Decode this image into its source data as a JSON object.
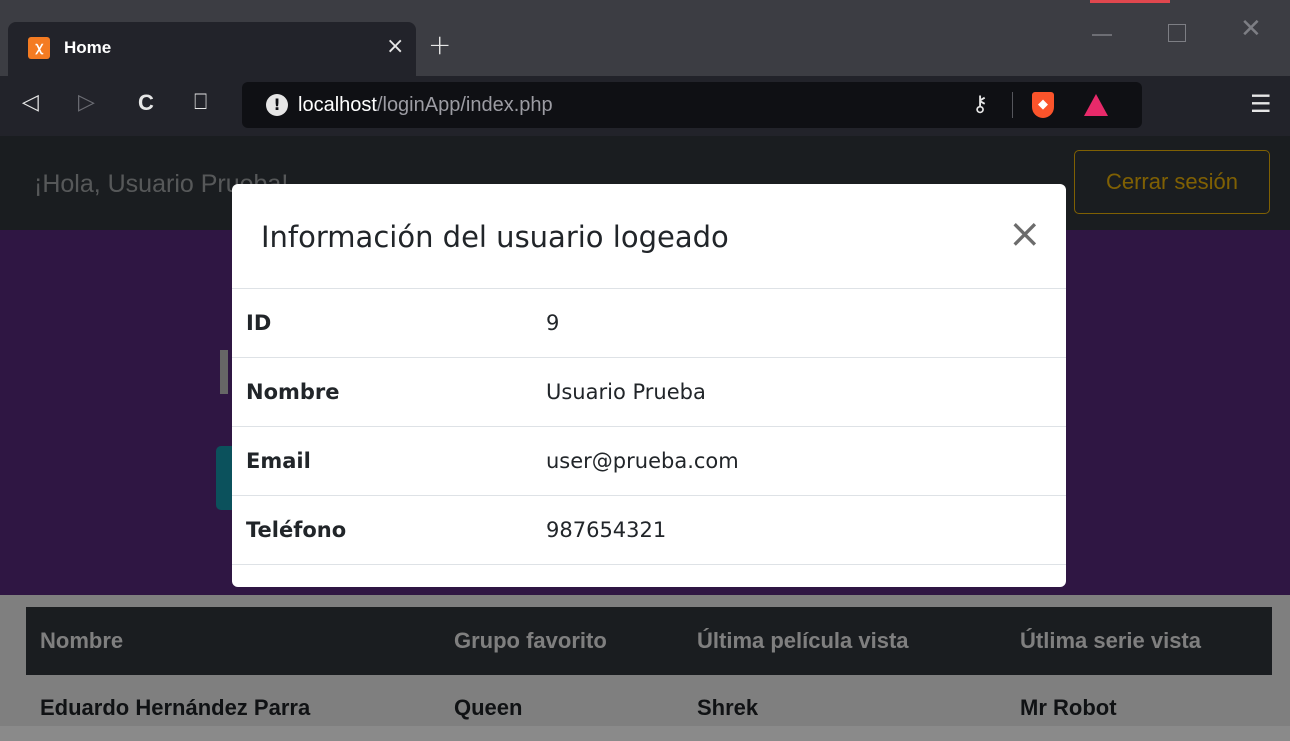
{
  "browser": {
    "tab_title": "Home",
    "tab_close": "×",
    "new_tab": "+",
    "address_host": "localhost",
    "address_path": "/loginApp/index.php",
    "nav": {
      "back": "◁",
      "forward": "▷",
      "reload": "C",
      "bookmark": "⎕"
    },
    "key_icon": "🔑",
    "menu_icon": "☰",
    "accent_color": "#e0474e"
  },
  "page": {
    "greeting": "¡Hola, Usuario Prueba!",
    "logout_label": "Cerrar sesión",
    "table": {
      "headers": [
        "Nombre",
        "Grupo favorito",
        "Última película vista",
        "Útlima serie vista"
      ],
      "rows": [
        [
          "Eduardo Hernández Parra",
          "Queen",
          "Shrek",
          "Mr Robot"
        ]
      ]
    }
  },
  "modal": {
    "title": "Información del usuario logeado",
    "close": "×",
    "rows": [
      {
        "label": "ID",
        "value": "9"
      },
      {
        "label": "Nombre",
        "value": "Usuario Prueba"
      },
      {
        "label": "Email",
        "value": "user@prueba.com"
      },
      {
        "label": "Teléfono",
        "value": "987654321"
      }
    ]
  }
}
